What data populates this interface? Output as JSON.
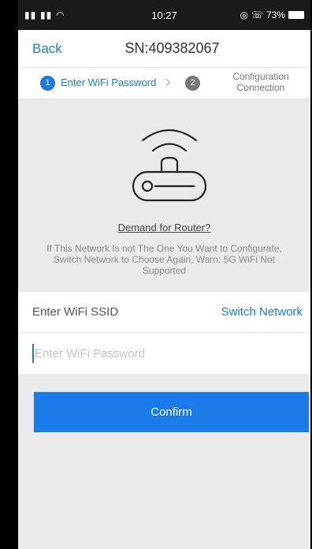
{
  "status_bar": {
    "signal": "๏๏๏",
    "time": "10:27",
    "icons": "ⓥ ✇",
    "battery": "73%"
  },
  "header": {
    "back_label": "Back",
    "title": "SN:409382067"
  },
  "steps": [
    {
      "number": "1",
      "label": "Enter WiFi Password",
      "active": true
    },
    {
      "number": "2",
      "label_line1": "Configuration",
      "label_line2": "Connection",
      "active": false
    }
  ],
  "illustration": {
    "demand_link": "Demand for Router?",
    "hint": "If This Network Is not The One You Want to Configurate, Switch Network to Choose Again, Warn: 5G WiFi Not Supported"
  },
  "form": {
    "ssid_label": "Enter WiFi SSID",
    "switch_network": "Switch Network",
    "password_placeholder": "Enter WiFi Password",
    "password_value": "",
    "confirm_label": "Confirm"
  },
  "colors": {
    "accent": "#1a7ae8",
    "background": "#eaeaea",
    "step_inactive": "#777777"
  }
}
